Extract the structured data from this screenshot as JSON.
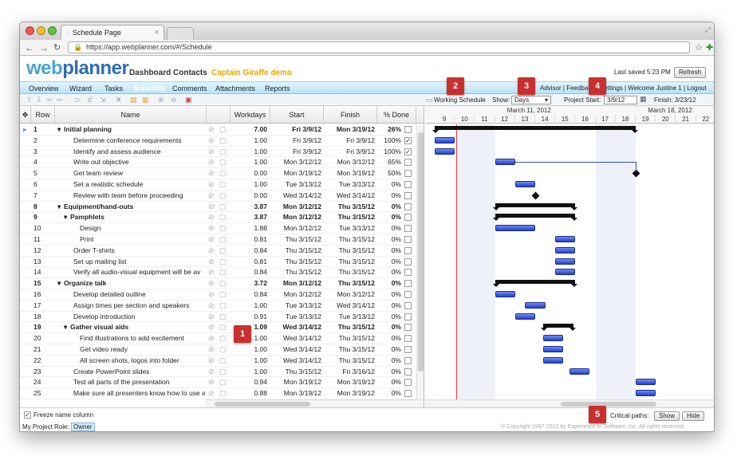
{
  "browser": {
    "tab_title": "Schedule Page",
    "url": "https://app.webplanner.com/#/Schedule"
  },
  "header": {
    "logo_web": "web",
    "logo_planner": "planner",
    "nav": [
      "Dashboard",
      "Contacts"
    ],
    "project_name": "Captain Giraffe demo",
    "last_saved": "Last saved 5:23 PM",
    "refresh_label": "Refresh"
  },
  "menu": {
    "items": [
      "Overview",
      "Wizard",
      "Tasks",
      "Schedule",
      "Comments",
      "Attachments",
      "Reports"
    ],
    "active": "Schedule",
    "right_links": "Advisor | Feedback | Settings | Welcome Justine 1 | Logout"
  },
  "toolbar": {
    "working_schedule": "Working Schedule",
    "show_label": "Show:",
    "show_value": "Days",
    "project_start_label": "Project Start:",
    "project_start_value": "3/9/12",
    "finish_label": "Finish: 3/23/12"
  },
  "grid": {
    "columns": [
      "Row",
      "Name",
      "Workdays",
      "Start",
      "Finish",
      "% Done"
    ],
    "rows": [
      {
        "row": "1",
        "name": "Initial planning",
        "work": "7.00",
        "start": "Fri 3/9/12",
        "finish": "Mon 3/19/12",
        "done": "26%",
        "level": 0,
        "bold": true,
        "check": false
      },
      {
        "row": "2",
        "name": "Determine conference requirements",
        "work": "1.00",
        "start": "Fri 3/9/12",
        "finish": "Fri 3/9/12",
        "done": "100%",
        "level": 1,
        "bold": false,
        "check": true
      },
      {
        "row": "3",
        "name": "Identify and assess audience",
        "work": "1.00",
        "start": "Fri 3/9/12",
        "finish": "Fri 3/9/12",
        "done": "100%",
        "level": 1,
        "bold": false,
        "check": true
      },
      {
        "row": "4",
        "name": "Write out objective",
        "work": "1.00",
        "start": "Mon 3/12/12",
        "finish": "Mon 3/12/12",
        "done": "65%",
        "level": 1,
        "bold": false,
        "check": false
      },
      {
        "row": "5",
        "name": "Get team review",
        "work": "0.00",
        "start": "Mon 3/19/12",
        "finish": "Mon 3/19/12",
        "done": "50%",
        "level": 1,
        "bold": false,
        "check": false
      },
      {
        "row": "6",
        "name": "Set a realistic schedule",
        "work": "1.00",
        "start": "Tue 3/13/12",
        "finish": "Tue 3/13/12",
        "done": "0%",
        "level": 1,
        "bold": false,
        "check": false
      },
      {
        "row": "7",
        "name": "Review with team before proceeding",
        "work": "0.00",
        "start": "Wed 3/14/12",
        "finish": "Wed 3/14/12",
        "done": "0%",
        "level": 1,
        "bold": false,
        "check": false
      },
      {
        "row": "8",
        "name": "Equipment/hand-outs",
        "work": "3.87",
        "start": "Mon 3/12/12",
        "finish": "Thu 3/15/12",
        "done": "0%",
        "level": 0,
        "bold": true,
        "check": false
      },
      {
        "row": "9",
        "name": "Pamphlets",
        "work": "3.87",
        "start": "Mon 3/12/12",
        "finish": "Thu 3/15/12",
        "done": "0%",
        "level": 1,
        "bold": true,
        "check": false
      },
      {
        "row": "10",
        "name": "Design",
        "work": "1.88",
        "start": "Mon 3/12/12",
        "finish": "Tue 3/13/12",
        "done": "0%",
        "level": 2,
        "bold": false,
        "check": false
      },
      {
        "row": "11",
        "name": "Print",
        "work": "0.81",
        "start": "Thu 3/15/12",
        "finish": "Thu 3/15/12",
        "done": "0%",
        "level": 2,
        "bold": false,
        "check": false
      },
      {
        "row": "12",
        "name": "Order T-shirts",
        "work": "0.84",
        "start": "Thu 3/15/12",
        "finish": "Thu 3/15/12",
        "done": "0%",
        "level": 1,
        "bold": false,
        "check": false
      },
      {
        "row": "13",
        "name": "Set up mailing list",
        "work": "0.81",
        "start": "Thu 3/15/12",
        "finish": "Thu 3/15/12",
        "done": "0%",
        "level": 1,
        "bold": false,
        "check": false
      },
      {
        "row": "14",
        "name": "Verify all audio-visual equipment will be av",
        "work": "0.84",
        "start": "Thu 3/15/12",
        "finish": "Thu 3/15/12",
        "done": "0%",
        "level": 1,
        "bold": false,
        "check": false
      },
      {
        "row": "15",
        "name": "Organize talk",
        "work": "3.72",
        "start": "Mon 3/12/12",
        "finish": "Thu 3/15/12",
        "done": "0%",
        "level": 0,
        "bold": true,
        "check": false
      },
      {
        "row": "16",
        "name": "Develop detailed outline",
        "work": "0.84",
        "start": "Mon 3/12/12",
        "finish": "Mon 3/12/12",
        "done": "0%",
        "level": 1,
        "bold": false,
        "check": false
      },
      {
        "row": "17",
        "name": "Assign times per section and speakers",
        "work": "1.00",
        "start": "Tue 3/13/12",
        "finish": "Wed 3/14/12",
        "done": "0%",
        "level": 1,
        "bold": false,
        "check": false
      },
      {
        "row": "18",
        "name": "Develop introduction",
        "work": "0.91",
        "start": "Tue 3/13/12",
        "finish": "Tue 3/13/12",
        "done": "0%",
        "level": 1,
        "bold": false,
        "check": false
      },
      {
        "row": "19",
        "name": "Gather visual aids",
        "work": "1.09",
        "start": "Wed 3/14/12",
        "finish": "Thu 3/15/12",
        "done": "0%",
        "level": 1,
        "bold": true,
        "check": false
      },
      {
        "row": "20",
        "name": "Find illustrations to add excitement",
        "work": "1.00",
        "start": "Wed 3/14/12",
        "finish": "Thu 3/15/12",
        "done": "0%",
        "level": 2,
        "bold": false,
        "check": false
      },
      {
        "row": "21",
        "name": "Get video ready",
        "work": "1.00",
        "start": "Wed 3/14/12",
        "finish": "Thu 3/15/12",
        "done": "0%",
        "level": 2,
        "bold": false,
        "check": false
      },
      {
        "row": "22",
        "name": "All screen shots, logos into folder",
        "work": "1.00",
        "start": "Wed 3/14/12",
        "finish": "Thu 3/15/12",
        "done": "0%",
        "level": 2,
        "bold": false,
        "check": false
      },
      {
        "row": "23",
        "name": "Create PowerPoint slides",
        "work": "1.00",
        "start": "Thu 3/15/12",
        "finish": "Fri 3/16/12",
        "done": "0%",
        "level": 1,
        "bold": false,
        "check": false
      },
      {
        "row": "24",
        "name": "Test all parts of the presentation",
        "work": "0.94",
        "start": "Mon 3/19/12",
        "finish": "Mon 3/19/12",
        "done": "0%",
        "level": 1,
        "bold": false,
        "check": false
      },
      {
        "row": "25",
        "name": "Make sure all presenters know how to use a",
        "work": "0.88",
        "start": "Mon 3/19/12",
        "finish": "Mon 3/19/12",
        "done": "0%",
        "level": 1,
        "bold": false,
        "check": false
      }
    ]
  },
  "gantt": {
    "weeks": [
      {
        "label": "March 11, 2012"
      },
      {
        "label": "March 18, 2012"
      }
    ],
    "days": [
      "9",
      "10",
      "11",
      "12",
      "13",
      "14",
      "15",
      "16",
      "17",
      "18",
      "19",
      "20",
      "21",
      "22"
    ],
    "weekend_days": [
      "10",
      "11",
      "17",
      "18"
    ],
    "bars": [
      {
        "row": 0,
        "type": "summary",
        "start": 9,
        "end": 19
      },
      {
        "row": 1,
        "type": "task",
        "start": 9,
        "end": 10
      },
      {
        "row": 2,
        "type": "task",
        "start": 9,
        "end": 10
      },
      {
        "row": 3,
        "type": "task",
        "start": 12,
        "end": 13
      },
      {
        "row": 4,
        "type": "milestone",
        "start": 19,
        "end": 19
      },
      {
        "row": 5,
        "type": "task",
        "start": 13,
        "end": 14
      },
      {
        "row": 6,
        "type": "milestone",
        "start": 14,
        "end": 14
      },
      {
        "row": 7,
        "type": "summary",
        "start": 12,
        "end": 16
      },
      {
        "row": 8,
        "type": "summary",
        "start": 12,
        "end": 16
      },
      {
        "row": 9,
        "type": "task",
        "start": 12,
        "end": 14
      },
      {
        "row": 10,
        "type": "task",
        "start": 15,
        "end": 16
      },
      {
        "row": 11,
        "type": "task",
        "start": 15,
        "end": 16
      },
      {
        "row": 12,
        "type": "task",
        "start": 15,
        "end": 16
      },
      {
        "row": 13,
        "type": "task",
        "start": 15,
        "end": 16
      },
      {
        "row": 14,
        "type": "summary",
        "start": 12,
        "end": 16
      },
      {
        "row": 15,
        "type": "task",
        "start": 12,
        "end": 13
      },
      {
        "row": 16,
        "type": "task",
        "start": 13.5,
        "end": 14.5
      },
      {
        "row": 17,
        "type": "task",
        "start": 13,
        "end": 14
      },
      {
        "row": 18,
        "type": "summary",
        "start": 14.4,
        "end": 15.9
      },
      {
        "row": 19,
        "type": "task",
        "start": 14.4,
        "end": 15.4
      },
      {
        "row": 20,
        "type": "task",
        "start": 14.4,
        "end": 15.4
      },
      {
        "row": 21,
        "type": "task",
        "start": 14.4,
        "end": 15.4
      },
      {
        "row": 22,
        "type": "task",
        "start": 15.7,
        "end": 16.7
      },
      {
        "row": 23,
        "type": "task",
        "start": 19,
        "end": 20
      },
      {
        "row": 24,
        "type": "task",
        "start": 19,
        "end": 20
      }
    ]
  },
  "footer": {
    "freeze_label": "Freeze name column",
    "role_label": "My Project Role:",
    "role_value": "Owner",
    "critical_label": "Critical paths:",
    "show_btn": "Show",
    "hide_btn": "Hide",
    "copyright": "© Copyright 1997-2012 by Experience In Software, Inc. All rights reserved"
  },
  "badges": [
    "1",
    "2",
    "3",
    "4",
    "5"
  ],
  "colors": {
    "accent": "#4aa3d8",
    "brand_blue": "#2d6db5",
    "bar_blue": "#2f4fd6",
    "badge_red": "#c8302f",
    "project_orange": "#f0a400"
  }
}
